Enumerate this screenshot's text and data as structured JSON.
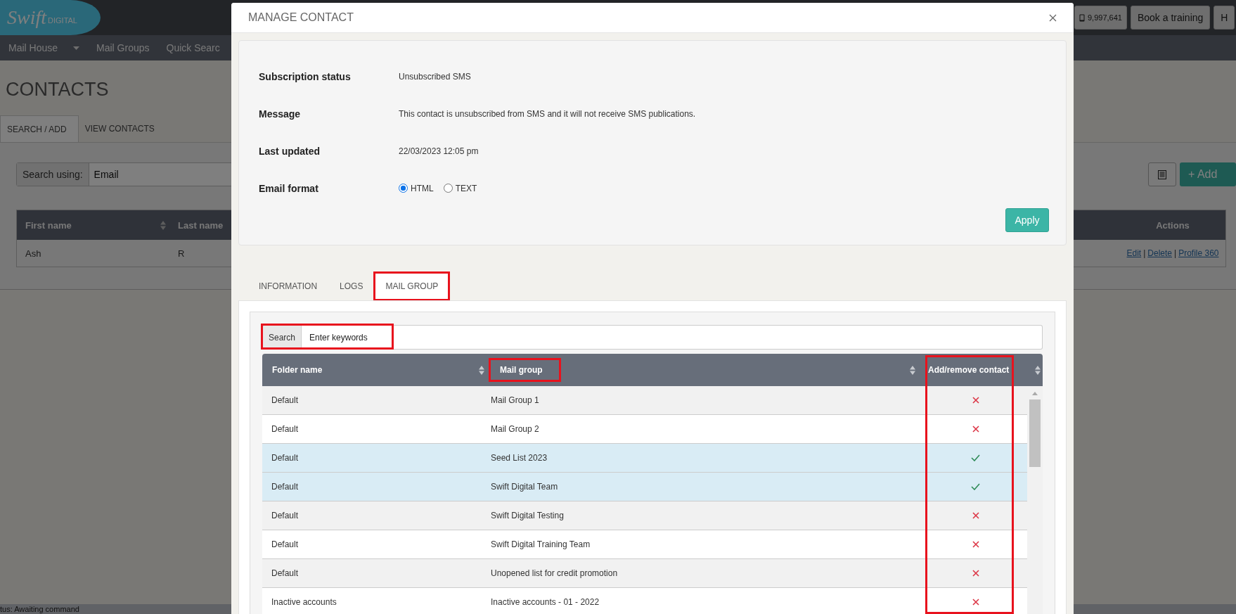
{
  "header": {
    "logo_script": "Swift",
    "logo_word": "DIGITAL",
    "buttons": [
      {
        "label": "9,997,641",
        "kind": "credits"
      },
      {
        "label": "Book a training",
        "kind": "plain"
      },
      {
        "label": "H",
        "kind": "plain"
      }
    ]
  },
  "nav": [
    {
      "label": "Mail House",
      "dropdown": true
    },
    {
      "label": "Mail Groups",
      "dropdown": false
    },
    {
      "label": "Quick Searc",
      "dropdown": false
    }
  ],
  "page": {
    "title": "CONTACTS",
    "tabs": [
      {
        "label": "SEARCH / ADD",
        "selected": true
      },
      {
        "label": "VIEW CONTACTS",
        "selected": false
      }
    ],
    "search": {
      "label": "Search using:",
      "value": "Email"
    },
    "add_button": "+ Add",
    "table": {
      "columns": [
        "First name",
        "Last name",
        "Actions"
      ],
      "separator": "|",
      "rows": [
        {
          "first": "Ash",
          "last": "R",
          "actions": [
            "Edit",
            "Delete",
            "Profile 360"
          ]
        }
      ]
    }
  },
  "status_bar": "tus: Awaiting command",
  "modal": {
    "title": "MANAGE CONTACT",
    "details": [
      {
        "label": "Subscription status",
        "value": "Unsubscribed SMS"
      },
      {
        "label": "Message",
        "value": "This contact is unsubscribed from SMS and it will not receive SMS publications."
      },
      {
        "label": "Last updated",
        "value": "22/03/2023 12:05 pm"
      }
    ],
    "email_format": {
      "label": "Email format",
      "options": [
        {
          "label": "HTML",
          "selected": true
        },
        {
          "label": "TEXT",
          "selected": false
        }
      ]
    },
    "apply_button": "Apply",
    "tabs": [
      {
        "label": "INFORMATION",
        "selected": false,
        "highlighted": false
      },
      {
        "label": "LOGS",
        "selected": false,
        "highlighted": false
      },
      {
        "label": "MAIL GROUP",
        "selected": true,
        "highlighted": true
      }
    ],
    "search": {
      "label": "Search",
      "placeholder": "Enter keywords",
      "highlighted": true
    },
    "table": {
      "columns": [
        {
          "label": "Folder name",
          "highlighted": false
        },
        {
          "label": "Mail group",
          "highlighted": true
        },
        {
          "label": "Add/remove contact",
          "highlighted": true
        }
      ],
      "rows": [
        {
          "folder": "Default",
          "group": "Mail Group 1",
          "member": false
        },
        {
          "folder": "Default",
          "group": "Mail Group 2",
          "member": false
        },
        {
          "folder": "Default",
          "group": "Seed List 2023",
          "member": true
        },
        {
          "folder": "Default",
          "group": "Swift Digital Team",
          "member": true
        },
        {
          "folder": "Default",
          "group": "Swift Digital Testing",
          "member": false
        },
        {
          "folder": "Default",
          "group": "Swift Digital Training Team",
          "member": false
        },
        {
          "folder": "Default",
          "group": "Unopened list for credit promotion",
          "member": false
        },
        {
          "folder": "Inactive accounts",
          "group": "Inactive accounts - 01 - 2022",
          "member": false
        }
      ]
    }
  }
}
